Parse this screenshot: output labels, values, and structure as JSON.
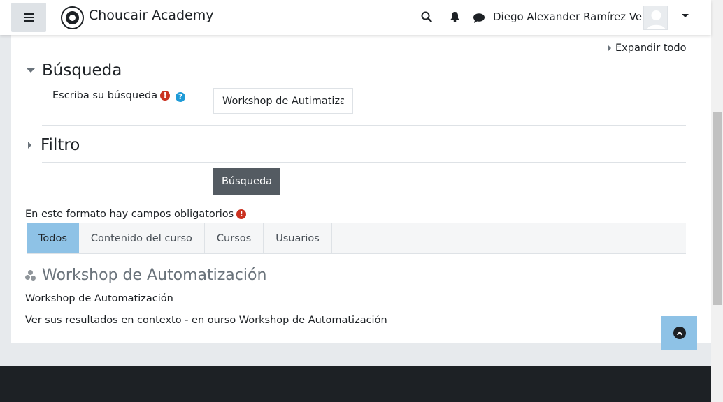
{
  "navbar": {
    "brand": "Choucair Academy",
    "user_name": "Diego Alexander Ramírez Vela",
    "icons": [
      "menu-icon",
      "logo-icon",
      "search-icon",
      "bell-icon",
      "chat-icon",
      "avatar-icon",
      "caret-down-icon"
    ]
  },
  "form": {
    "expand_all": "Expandir todo",
    "search_section": {
      "title": "Búsqueda",
      "label": "Escriba su búsqueda",
      "value": "Workshop de Autimatiza"
    },
    "filter_section": {
      "title": "Filtro"
    },
    "submit_label": "Búsqueda",
    "required_note": "En este formato hay campos obligatorios"
  },
  "tabs": [
    {
      "label": "Todos",
      "active": true
    },
    {
      "label": "Contenido del curso",
      "active": false
    },
    {
      "label": "Cursos",
      "active": false
    },
    {
      "label": "Usuarios",
      "active": false
    }
  ],
  "result": {
    "title": "Workshop de Automatización",
    "subtitle": "Workshop de Automatización",
    "context": "Ver sus resultados en contexto - en ourso Workshop de Automatización"
  },
  "colors": {
    "active_tab": "#8ec2e6",
    "button": "#545b62",
    "required": "#ca3120",
    "help": "#1f9bd7",
    "footer": "#1d2125"
  }
}
